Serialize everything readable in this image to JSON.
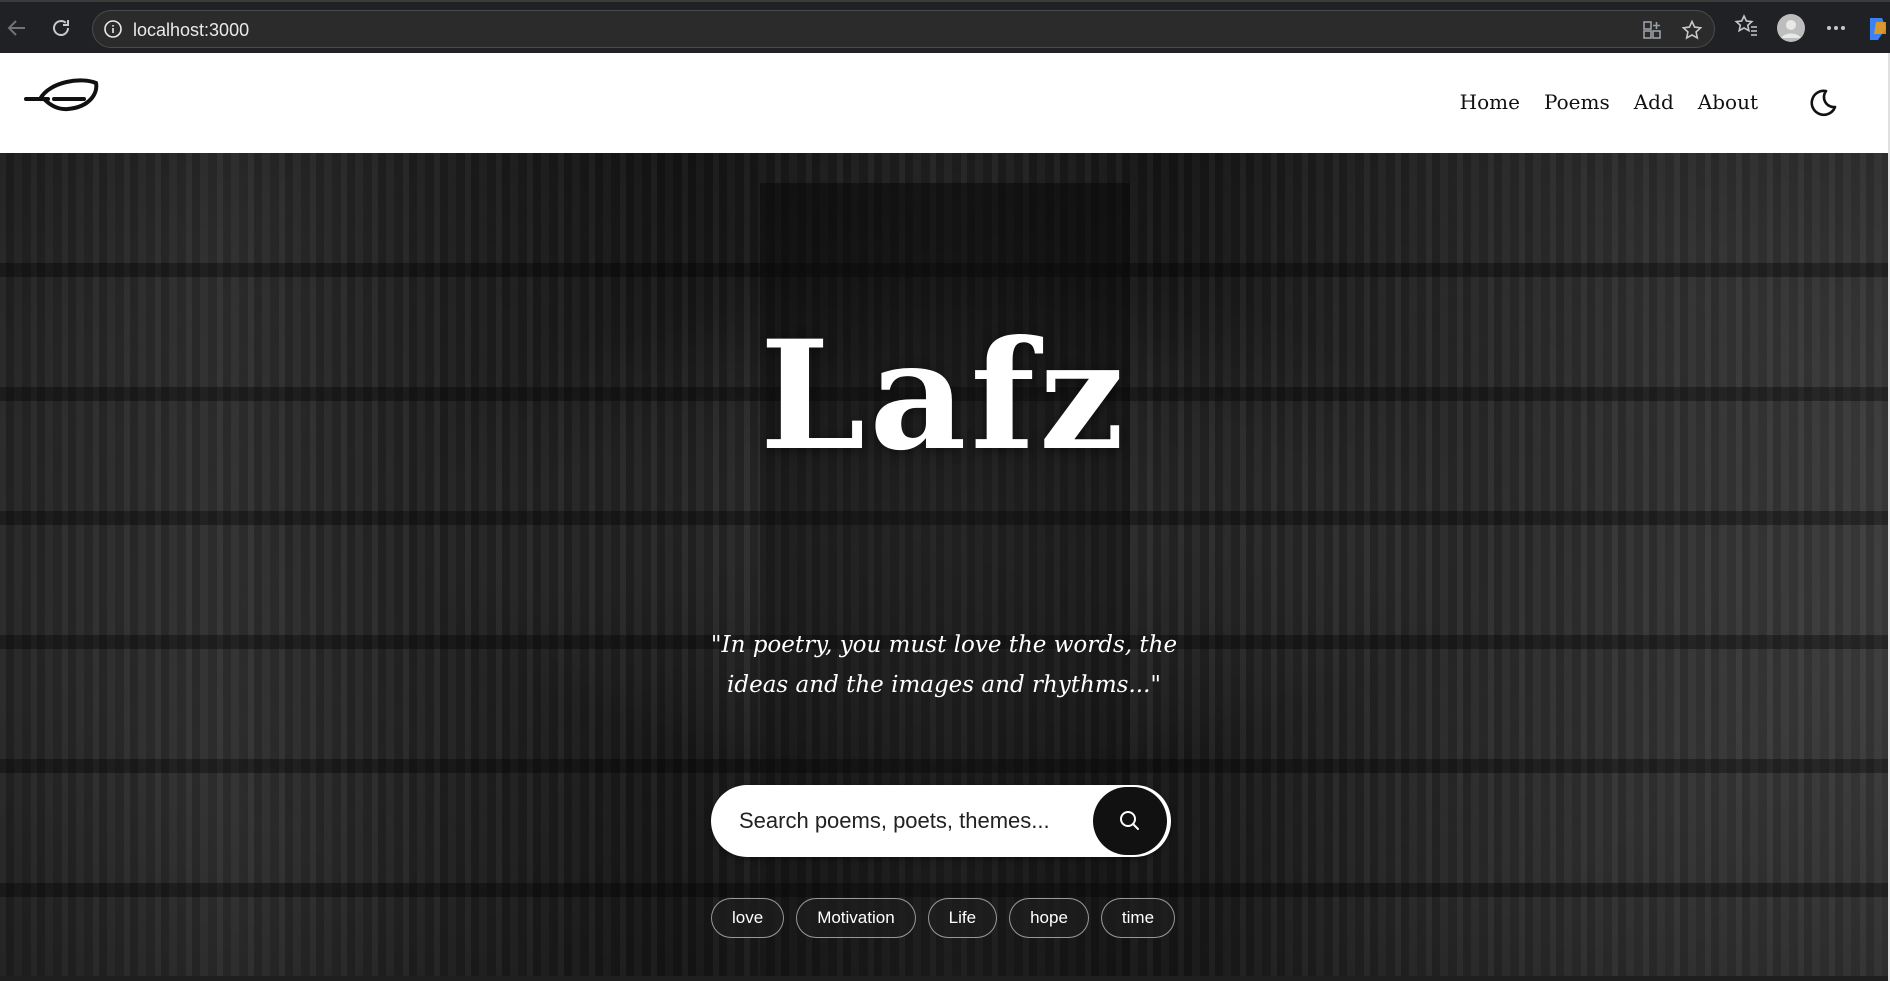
{
  "browser": {
    "url": "localhost:3000"
  },
  "header": {
    "nav": [
      "Home",
      "Poems",
      "Add",
      "About"
    ],
    "theme_toggle_icon": "moon-icon"
  },
  "hero": {
    "title": "Lafz",
    "quote_line1": "\"In poetry, you must love the words, the",
    "quote_line2": "ideas and the images and rhythms...\"",
    "search_placeholder": "Search poems, poets, themes...",
    "tags": [
      "love",
      "Motivation",
      "Life",
      "hope",
      "time"
    ]
  },
  "colors": {
    "header_bg": "#ffffff",
    "text_dark": "#111111",
    "search_button": "#111111"
  }
}
